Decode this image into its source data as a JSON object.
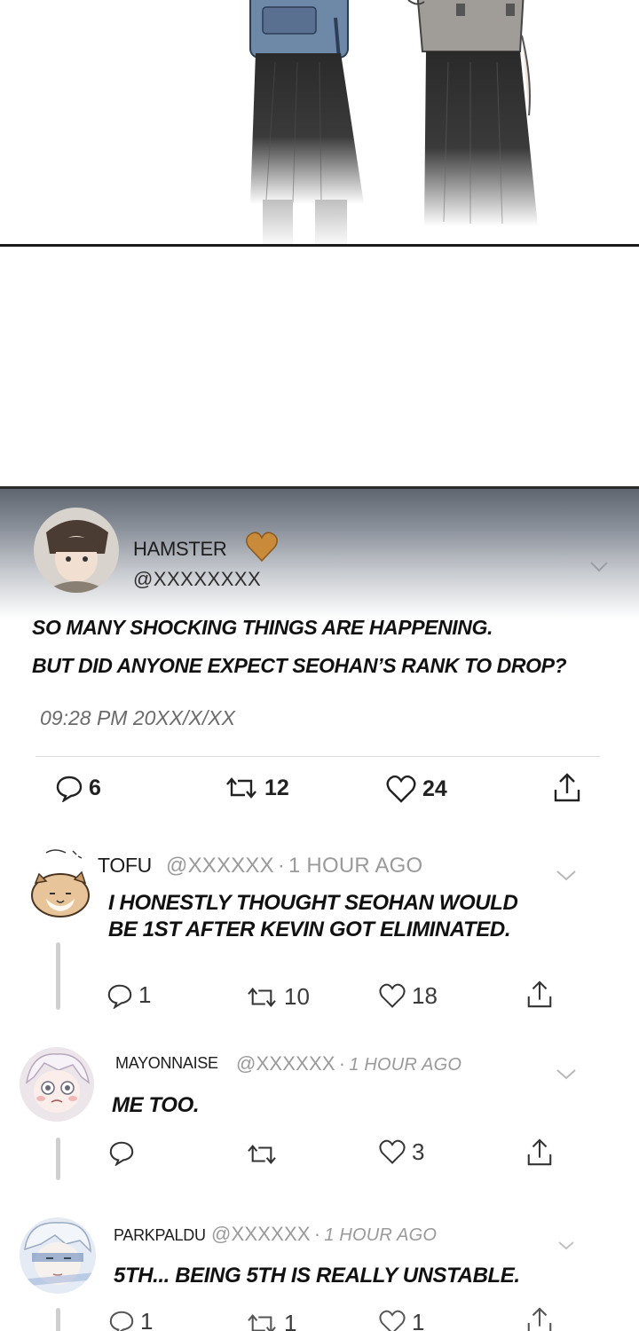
{
  "post": {
    "display_name": "HAMSTER",
    "handle": "@XXXXXXXX",
    "line1": "SO MANY SHOCKING THINGS ARE HAPPENING.",
    "line2": "BUT DID ANYONE EXPECT SEOHAN’S RANK TO DROP?",
    "timestamp": "09:28 PM 20XX/X/XX",
    "replies": "6",
    "reposts": "12",
    "likes": "24",
    "heart_color": "#c98a3a"
  },
  "replies": [
    {
      "display_name": "TOFU",
      "handle": "@XXXXXX",
      "time": "1 HOUR AGO",
      "line1": "I HONESTLY THOUGHT SEOHAN WOULD",
      "line2": "BE 1ST AFTER KEVIN GOT ELIMINATED.",
      "replies": "1",
      "reposts": "10",
      "likes": "18"
    },
    {
      "display_name": "MAYONNAISE",
      "handle": "@XXXXXX",
      "time": "1 HOUR AGO",
      "line1": "ME TOO.",
      "replies": "",
      "reposts": "",
      "likes": "3"
    },
    {
      "display_name": "PARKPALDU",
      "handle": "@XXXXXX",
      "time": "1 HOUR AGO",
      "line1": "5TH... BEING 5TH IS REALLY UNSTABLE.",
      "replies": "1",
      "reposts": "1",
      "likes": "1"
    }
  ],
  "icons": [
    "reply-icon",
    "repost-icon",
    "like-icon",
    "share-icon",
    "chevron-down-icon"
  ]
}
